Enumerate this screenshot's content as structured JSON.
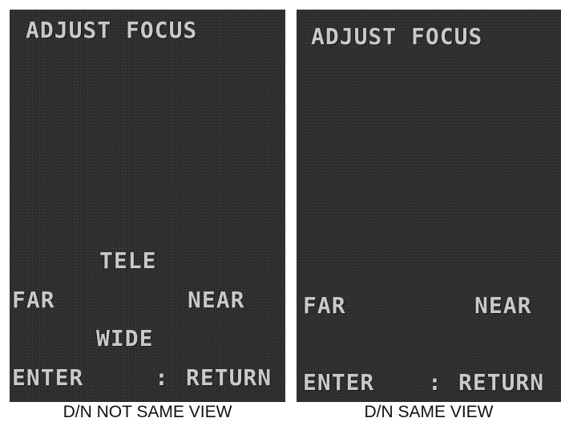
{
  "left_panel": {
    "title": "ADJUST FOCUS",
    "tele": "TELE",
    "far": "FAR",
    "near": "NEAR",
    "wide": "WIDE",
    "enter": "ENTER",
    "separator": ":",
    "return": "RETURN",
    "caption": "D/N NOT SAME VIEW"
  },
  "right_panel": {
    "title": "ADJUST FOCUS",
    "far": "FAR",
    "near": "NEAR",
    "enter": "ENTER",
    "separator": ":",
    "return": "RETURN",
    "caption": "D/N SAME VIEW"
  },
  "colors": {
    "osd_text": "#c9c9c9",
    "screen_background": "#2c2c2c"
  }
}
